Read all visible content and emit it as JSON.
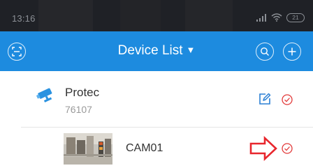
{
  "status_bar": {
    "time": "13:16",
    "signal_icon": "signal-bars-icon",
    "wifi_icon": "wifi-icon",
    "battery_level": "21"
  },
  "header": {
    "title": "Device List",
    "caret": "▼",
    "left_icon": "scan-icon",
    "right_icons": [
      "search-icon",
      "plus-icon"
    ],
    "background": "#1d8bdf"
  },
  "devices": [
    {
      "name": "Protec",
      "id": "76107",
      "icon": "security-camera-icon",
      "edit_icon": "edit-icon",
      "select_icon": "check-circle-icon",
      "channels": [
        {
          "name": "CAM01",
          "thumbnail": "camera-snapshot",
          "select_icon": "check-circle-icon",
          "annotation": "red-outline-arrow-icon"
        }
      ]
    }
  ],
  "colors": {
    "accent": "#1d8bdf",
    "check": "#e23b3b",
    "annotation_arrow": "#e8262d"
  }
}
